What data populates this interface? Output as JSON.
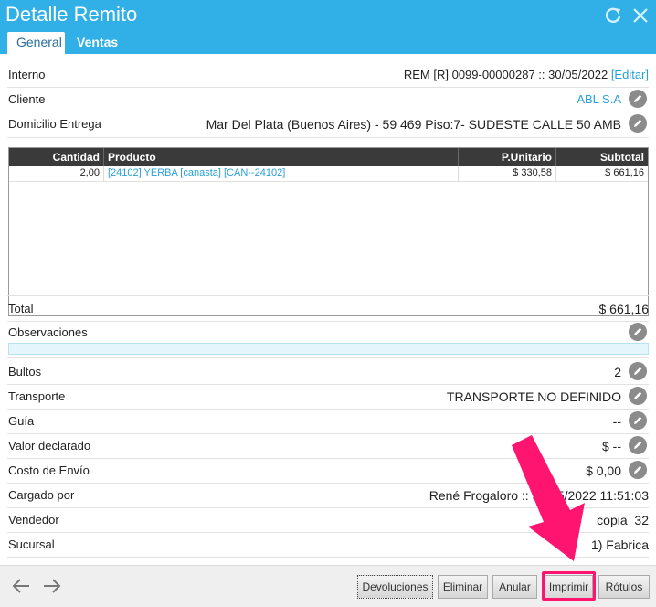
{
  "window": {
    "title": "Detalle Remito"
  },
  "tabs": [
    {
      "label": "General"
    },
    {
      "label": "Ventas"
    }
  ],
  "fields": {
    "interno": {
      "label": "Interno",
      "value": "REM [R] 0099-00000287 :: 30/05/2022",
      "edit_link": "[Editar]"
    },
    "cliente": {
      "label": "Cliente",
      "value": "ABL S.A"
    },
    "domicilio": {
      "label": "Domicilio Entrega",
      "value": "Mar Del Plata (Buenos Aires) - 59 469 Piso:7- SUDESTE CALLE 50 AMB"
    }
  },
  "grid": {
    "columns": [
      "Cantidad",
      "Producto",
      "P.Unitario",
      "Subtotal"
    ],
    "rows": [
      {
        "cantidad": "2,00",
        "producto": "[24102] YERBA [canasta] [CAN--24102]",
        "unitario": "$ 330,58",
        "subtotal": "$ 661,16"
      }
    ]
  },
  "summary": {
    "total": {
      "label": "Total",
      "value": "$ 661,16"
    },
    "observaciones": {
      "label": "Observaciones",
      "value": ""
    },
    "bultos": {
      "label": "Bultos",
      "value": "2"
    },
    "transporte": {
      "label": "Transporte",
      "value": "TRANSPORTE NO DEFINIDO"
    },
    "guia": {
      "label": "Guía",
      "value": "--"
    },
    "valor_declarado": {
      "label": "Valor declarado",
      "value": "$ --"
    },
    "costo_envio": {
      "label": "Costo de Envío",
      "value": "$ 0,00"
    },
    "cargado_por": {
      "label": "Cargado por",
      "value": "René Frogaloro :: 30/05/2022 11:51:03"
    },
    "vendedor": {
      "label": "Vendedor",
      "value": "copia_32"
    },
    "sucursal": {
      "label": "Sucursal",
      "value": "1) Fabrica"
    }
  },
  "footer": {
    "buttons": {
      "devoluciones": "Devoluciones",
      "eliminar": "Eliminar",
      "anular": "Anular",
      "imprimir": "Imprimir",
      "rotulos": "Rótulos"
    }
  },
  "icons": {
    "refresh": "refresh-icon",
    "close": "close-icon",
    "edit": "pencil-icon",
    "back": "arrow-left-icon",
    "forward": "arrow-right-icon"
  },
  "colors": {
    "header": "#30b0e6",
    "link": "#26a0d8",
    "highlight": "#ff1470"
  }
}
